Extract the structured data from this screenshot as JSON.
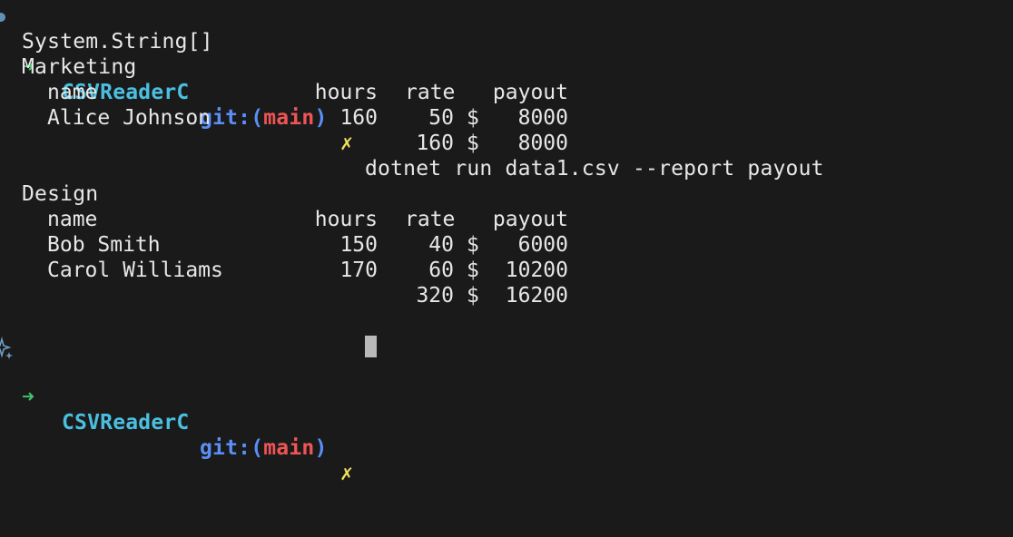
{
  "prompt": {
    "arrow": "➜",
    "directory": "CSVReaderC",
    "git_prefix": "git:(",
    "branch": "main",
    "git_suffix": ")",
    "dirty_mark": "✗",
    "command": "dotnet run data1.csv --report payout"
  },
  "output": {
    "type_line": "System.String[]",
    "groups": [
      {
        "title": "Marketing",
        "headers": {
          "name": "name",
          "hours": "hours",
          "rate": "rate",
          "payout": "payout"
        },
        "rows": [
          {
            "name": "Alice Johnson",
            "hours": "160",
            "rate": "50",
            "dollar": "$",
            "payout": "8000"
          }
        ],
        "total": {
          "hours": "160",
          "dollar": "$",
          "payout": "8000"
        }
      },
      {
        "title": "Design",
        "headers": {
          "name": "name",
          "hours": "hours",
          "rate": "rate",
          "payout": "payout"
        },
        "rows": [
          {
            "name": "Bob Smith",
            "hours": "150",
            "rate": "40",
            "dollar": "$",
            "payout": "6000"
          },
          {
            "name": "Carol Williams",
            "hours": "170",
            "rate": "60",
            "dollar": "$",
            "payout": "10200"
          }
        ],
        "total": {
          "hours": "320",
          "dollar": "$",
          "payout": "16200"
        }
      }
    ]
  },
  "colors": {
    "background": "#1a1a1b",
    "arrow": "#41c16c",
    "directory": "#4bbfe0",
    "git": "#5a8ff6",
    "branch": "#f05555",
    "dirty": "#f1e15e"
  },
  "icons": {
    "status_dot": "status-dot-icon",
    "sparkle": "sparkle-icon"
  }
}
